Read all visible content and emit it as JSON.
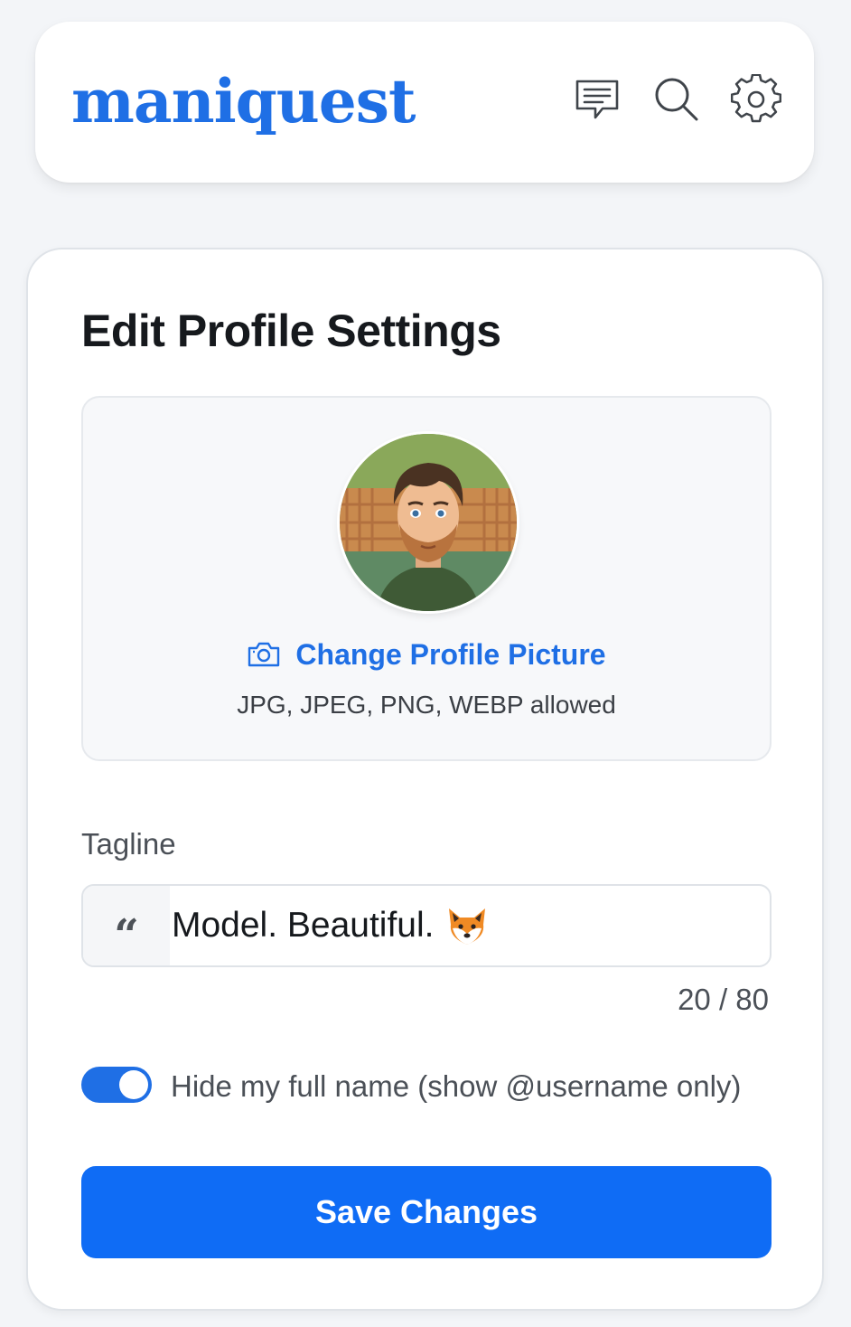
{
  "header": {
    "logo": "maniquest",
    "icons": [
      "messages-icon",
      "search-icon",
      "settings-gear-icon"
    ]
  },
  "profile": {
    "title": "Edit Profile Settings",
    "avatar_description": "profile-avatar",
    "change_picture_label": "Change Profile Picture",
    "change_picture_icon": "camera-icon",
    "allowed_formats": "JPG, JPEG, PNG, WEBP allowed"
  },
  "tagline": {
    "label": "Tagline",
    "quote_glyph": "“",
    "value": "Model. Beautiful.",
    "emoji_icon": "fox-emoji",
    "counter": "20 / 80"
  },
  "privacy": {
    "toggle_on": true,
    "label": "Hide my full name (show @username only)"
  },
  "actions": {
    "save_label": "Save Changes"
  },
  "colors": {
    "accent": "#1f6fe5",
    "button": "#0f6cf5",
    "page_bg": "#f3f5f8"
  }
}
